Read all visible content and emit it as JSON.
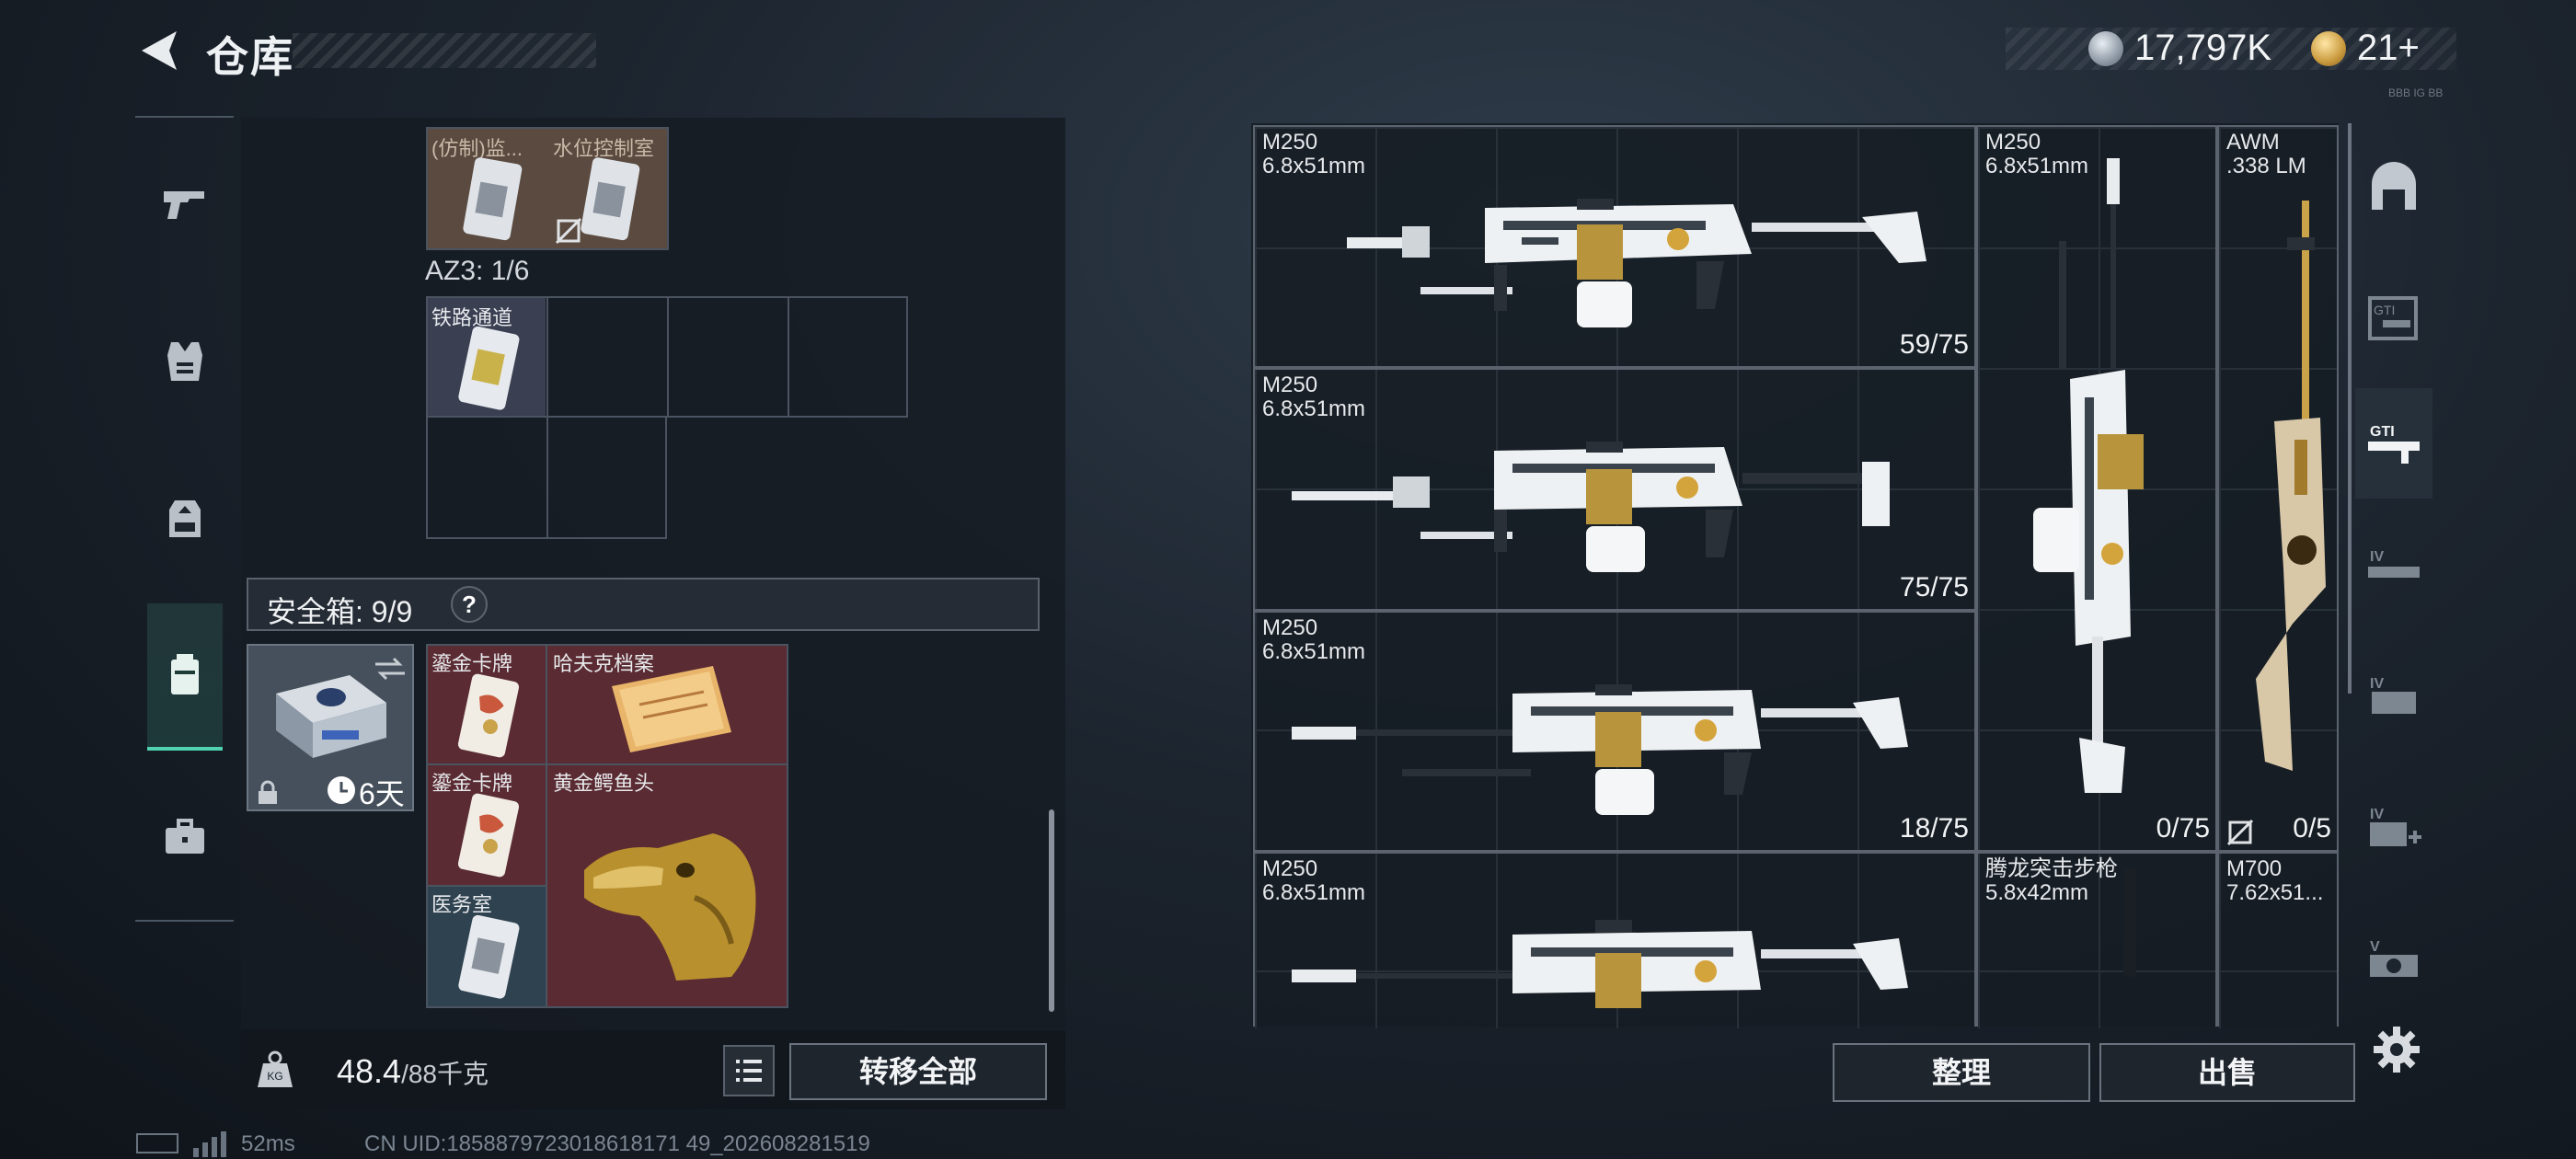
{
  "header": {
    "title": "仓库",
    "currency_silver": "17,797K",
    "currency_gold": "21+",
    "faint_text": "BBB IG BB"
  },
  "left_rail": {
    "items": [
      "weapons",
      "armor-vest",
      "backpack",
      "case",
      "briefcase"
    ]
  },
  "inventory": {
    "cards_top": [
      {
        "label": "(仿制)监..."
      },
      {
        "label": "水位控制室"
      }
    ],
    "az3_label": "AZ3: 1/6",
    "az3_cards": [
      {
        "label": "铁路通道"
      }
    ],
    "secure": {
      "label": "安全箱: 9/9",
      "help": "?",
      "days": "6天",
      "items": [
        {
          "label": "鎏金卡牌"
        },
        {
          "label": "哈夫克档案"
        },
        {
          "label": "鎏金卡牌"
        },
        {
          "label": "黄金鳄鱼头"
        },
        {
          "label": "医务室"
        }
      ]
    }
  },
  "footer_left": {
    "weight_current": "48.4",
    "weight_max": "/88千克",
    "transfer_label": "转移全部"
  },
  "status": {
    "ping": "52ms",
    "uid": "CN UID:1858879723018618171 49_202608281519"
  },
  "weapons": [
    {
      "name": "M250",
      "caliber": "6.8x51mm",
      "ammo": "59/75"
    },
    {
      "name": "M250",
      "caliber": "6.8x51mm",
      "ammo": "75/75"
    },
    {
      "name": "M250",
      "caliber": "6.8x51mm",
      "ammo": "18/75"
    },
    {
      "name": "M250",
      "caliber": "6.8x51mm",
      "ammo": ""
    },
    {
      "name": "M250",
      "caliber": "6.8x51mm",
      "ammo": "0/75"
    },
    {
      "name": "AWM",
      "caliber": ".338 LM",
      "ammo": "0/5"
    },
    {
      "name": "腾龙突击步枪",
      "caliber": "5.8x42mm",
      "ammo": ""
    },
    {
      "name": "M700",
      "caliber": "7.62x51...",
      "ammo": ""
    }
  ],
  "right_rail": {
    "items": [
      "home-icon",
      "gti-icon",
      "gti-icon-active",
      "iv-icon",
      "iv-icon",
      "iv-plus-icon",
      "v-icon"
    ]
  },
  "footer_right": {
    "sort_label": "整理",
    "sell_label": "出售"
  }
}
